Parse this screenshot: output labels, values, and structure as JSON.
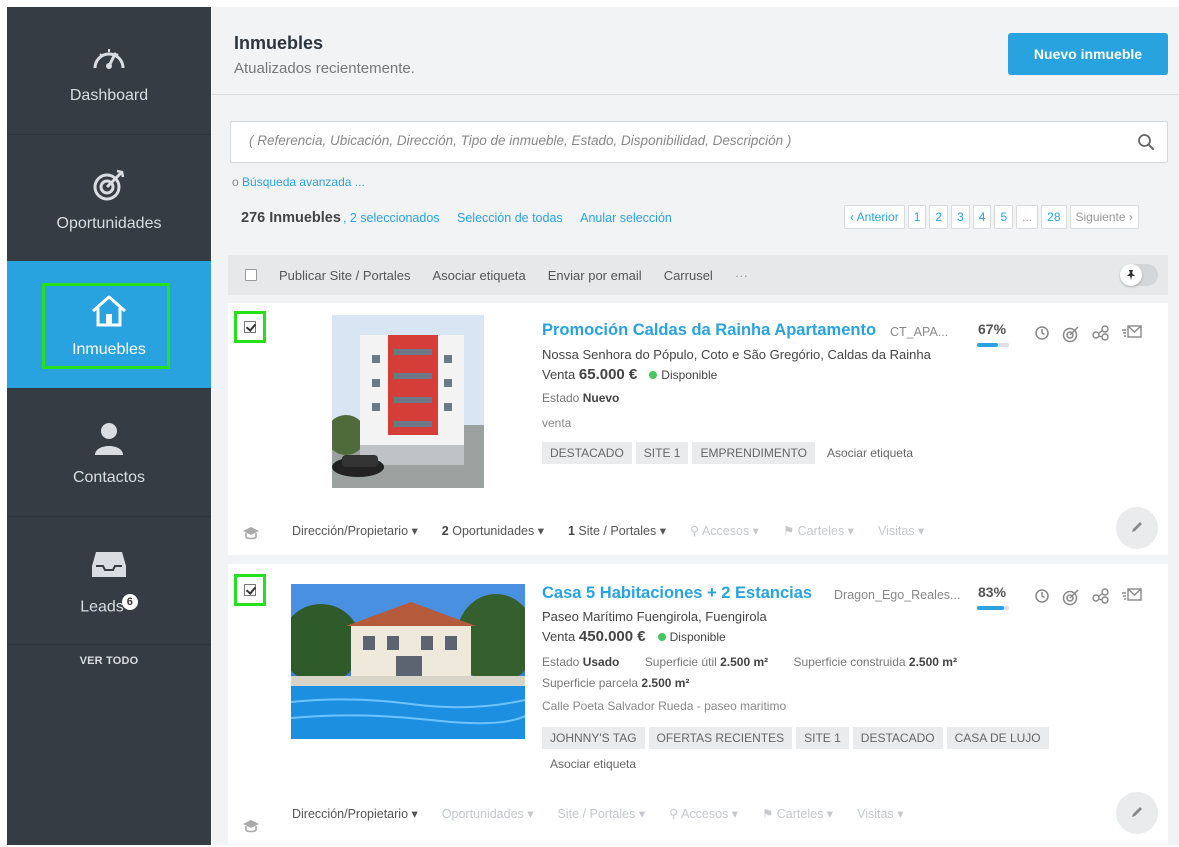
{
  "sidebar": {
    "items": [
      {
        "label": "Dashboard",
        "icon": "speedometer-icon"
      },
      {
        "label": "Oportunidades",
        "icon": "target-icon"
      },
      {
        "label": "Inmuebles",
        "icon": "home-icon",
        "active": true
      },
      {
        "label": "Contactos",
        "icon": "user-icon"
      },
      {
        "label": "Leads",
        "icon": "inbox-icon",
        "badge": "6"
      }
    ],
    "ver_todo": "VER TODO"
  },
  "header": {
    "title": "Inmuebles",
    "subtitle": "Atualizados recientemente.",
    "new_button": "Nuevo inmueble"
  },
  "search": {
    "placeholder": "( Referencia, Ubicación, Dirección, Tipo de inmueble, Estado, Disponibilidad, Descripción )",
    "advanced_prefix": "o ",
    "advanced_link": "Búsqueda avanzada ..."
  },
  "results": {
    "count": "276 Inmuebles",
    "selected": ", 2 seleccionados",
    "select_all": "Selección de todas",
    "clear_selection": "Anular selección"
  },
  "pagination": {
    "prev": "‹ Anterior",
    "pages": [
      "1",
      "2",
      "3",
      "4",
      "5"
    ],
    "ellipsis": "...",
    "last": "28",
    "next": "Siguiente ›"
  },
  "actions": {
    "items": [
      "Publicar Site / Portales",
      "Asociar etiqueta",
      "Enviar por email",
      "Carrusel",
      "···"
    ]
  },
  "properties": [
    {
      "title": "Promoción Caldas da Rainha Apartamento",
      "ref": "CT_APA...",
      "completion": "67%",
      "completion_value": 67,
      "location": "Nossa Senhora do Pópulo, Coto e São Gregório, Caldas da Rainha",
      "price_label": "Venta",
      "price": "65.000 €",
      "availability": "Disponible",
      "state_label": "Estado",
      "state": "Nuevo",
      "extra": "venta",
      "tags": [
        "DESTACADO",
        "SITE 1",
        "EMPRENDIMENTO"
      ],
      "add_tag": "Asociar etiqueta",
      "footer": {
        "owner": "Dirección/Propietario",
        "opps_count": "2",
        "opps": "Oportunidades",
        "sites_count": "1",
        "sites": "Site / Portales",
        "access": "Accesos",
        "signs": "Carteles",
        "visits": "Visitas"
      }
    },
    {
      "title": "Casa 5 Habitaciones + 2 Estancias",
      "ref": "Dragon_Ego_Reales...",
      "completion": "83%",
      "completion_value": 83,
      "location": "Paseo Marítimo Fuengirola, Fuengirola",
      "price_label": "Venta",
      "price": "450.000 €",
      "availability": "Disponible",
      "state_label": "Estado",
      "state": "Usado",
      "useful_label": "Superficie útil",
      "useful": "2.500 m²",
      "built_label": "Superficie construida",
      "built": "2.500 m²",
      "plot_label": "Superficie parcela",
      "plot": "2.500 m²",
      "address": "Calle Poeta Salvador Rueda - paseo maritimo",
      "tags": [
        "JOHNNY'S TAG",
        "OFERTAS RECIENTES",
        "SITE 1",
        "DESTACADO",
        "CASA DE LUJO"
      ],
      "add_tag": "Asociar etiqueta",
      "footer": {
        "owner": "Dirección/Propietario",
        "opps": "Oportunidades",
        "sites": "Site / Portales",
        "access": "Accesos",
        "signs": "Carteles",
        "visits": "Visitas"
      }
    }
  ]
}
